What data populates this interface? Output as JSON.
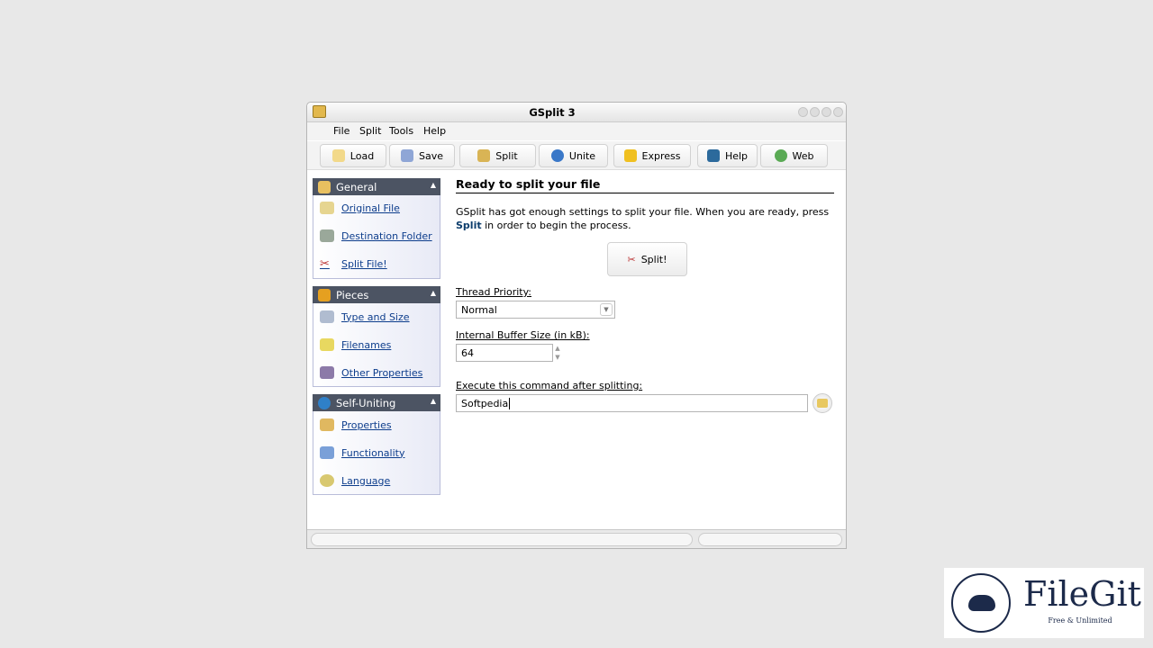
{
  "window": {
    "title": "GSplit 3"
  },
  "menu": [
    "File",
    "Split",
    "Tools",
    "Help"
  ],
  "toolbar": [
    {
      "label": "Load",
      "icon": "load-icon"
    },
    {
      "label": "Save",
      "icon": "save-icon"
    },
    {
      "label": "Split",
      "icon": "split-icon"
    },
    {
      "label": "Unite",
      "icon": "unite-icon"
    },
    {
      "label": "Express",
      "icon": "express-icon"
    },
    {
      "label": "Help",
      "icon": "help-book-icon"
    },
    {
      "label": "Web",
      "icon": "globe-icon"
    }
  ],
  "sidebar": [
    {
      "title": "General",
      "items": [
        "Original File",
        "Destination Folder",
        "Split File!"
      ]
    },
    {
      "title": "Pieces",
      "items": [
        "Type and Size",
        "Filenames",
        "Other Properties"
      ]
    },
    {
      "title": "Self-Uniting",
      "items": [
        "Properties",
        "Functionality",
        "Language"
      ]
    }
  ],
  "main": {
    "heading": "Ready to split your file",
    "desc_before": "GSplit has got enough settings to split your file. When you are ready, press ",
    "desc_bold": "Split",
    "desc_after": " in order to begin the process.",
    "split_button": "Split!",
    "thread_label": "Thread Priority:",
    "thread_value": "Normal",
    "buffer_label": "Internal Buffer Size (in kB):",
    "buffer_value": "64",
    "command_label": "Execute this command after splitting:",
    "command_value": "Softpedia"
  },
  "watermark": {
    "name": "FileGit",
    "tagline": "Free & Unlimited"
  }
}
